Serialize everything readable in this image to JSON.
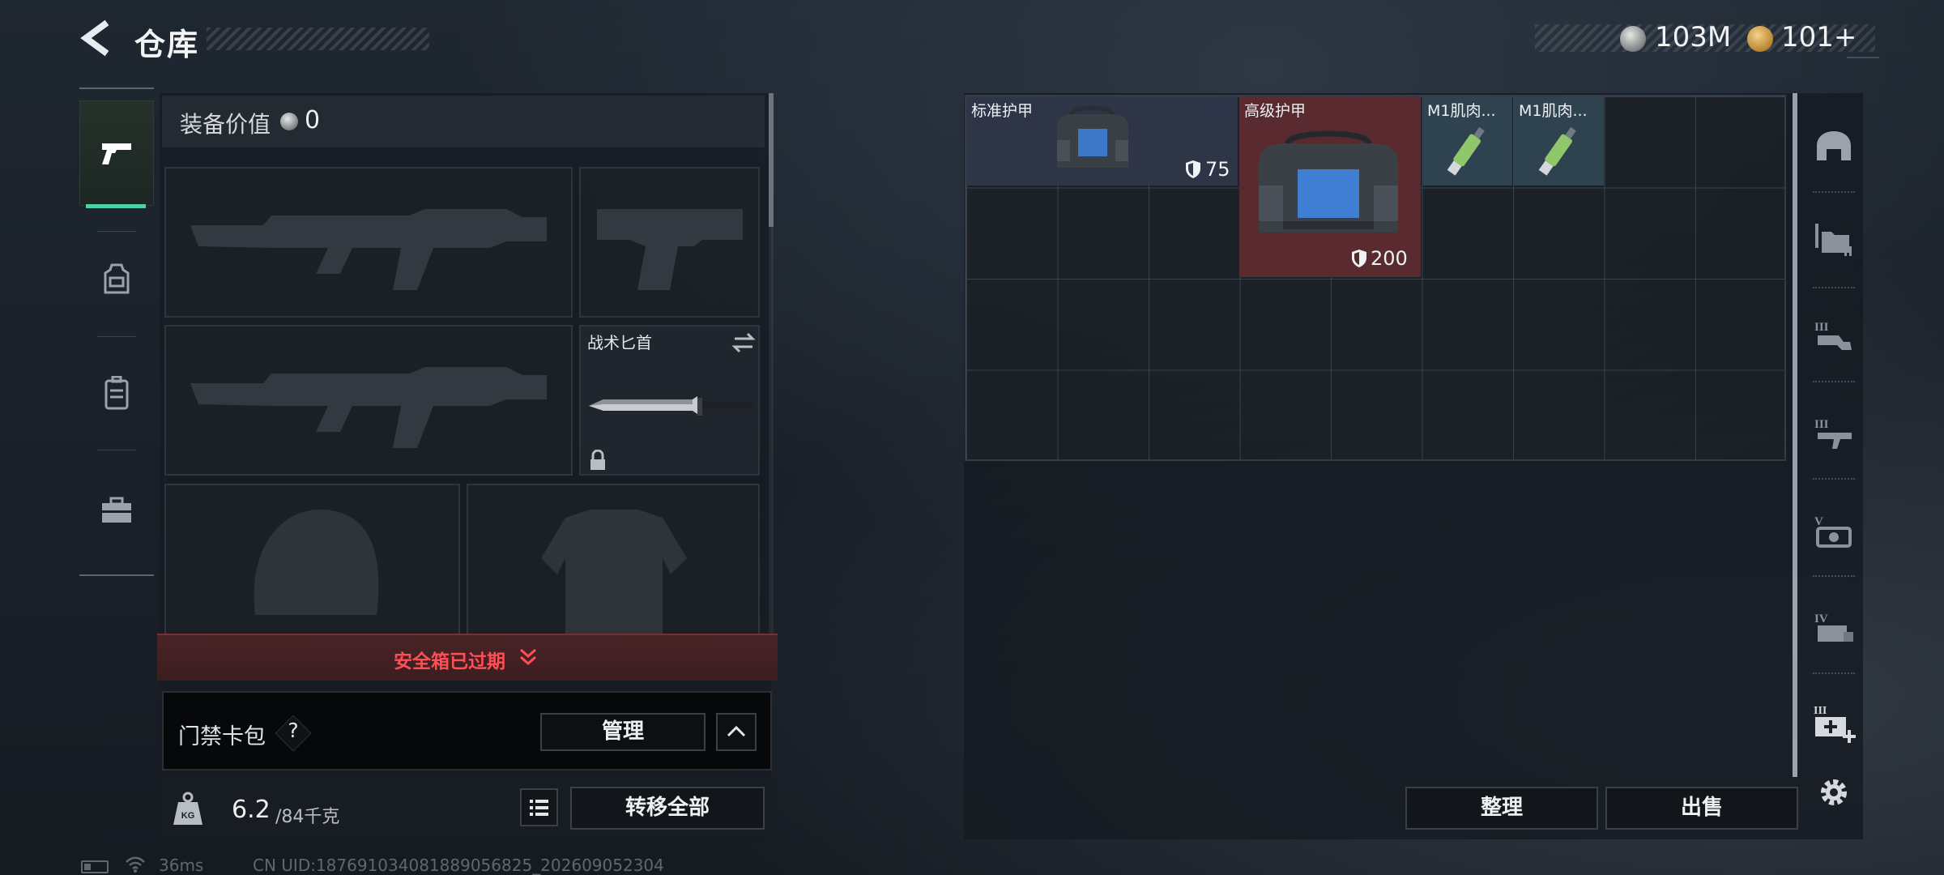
{
  "header": {
    "title": "仓库"
  },
  "currency": [
    {
      "icon": "silver-coin-icon",
      "value": "103M"
    },
    {
      "icon": "gold-coin-icon",
      "value": "101+"
    }
  ],
  "categories": [
    {
      "icon": "pistol-icon",
      "active": true
    },
    {
      "icon": "gear-vest-icon",
      "active": false
    },
    {
      "icon": "backpack-icon",
      "active": false
    },
    {
      "icon": "toolbox-icon",
      "active": false
    }
  ],
  "equipment": {
    "value_label": "装备价值",
    "value": "0",
    "knife_name": "战术匕首",
    "safebox_status": "安全箱已过期",
    "keycard_label": "门禁卡包",
    "keycard_help": "?",
    "manage_label": "管理",
    "weight_current": "6.2",
    "weight_max": "/84千克",
    "transfer_all_label": "转移全部"
  },
  "stash": {
    "items": [
      {
        "name": "标准护甲",
        "armor": "75"
      },
      {
        "name": "高级护甲",
        "armor": "200"
      },
      {
        "name": "M1肌肉..."
      },
      {
        "name": "M1肌肉..."
      }
    ],
    "sort_label": "整理",
    "sell_label": "出售"
  },
  "right_tabs": [
    "helmet-tab-icon",
    "folder-tab-icon",
    "level3-item-tab-icon",
    "level3-gun-tab-icon",
    "level5-gun-tab-icon",
    "level4-box-tab-icon",
    "medkit-add-tab-icon",
    "settings-gear-icon"
  ],
  "status": {
    "ping": "36ms",
    "uid": "CN UID:18769103408188905682​5_202609052304"
  },
  "colors": {
    "accent_active": "#4fd1a6",
    "safebox_warning": "#ff4f55",
    "advanced_armor_bg": "#5a2a31",
    "standard_armor_bg": "#30384e"
  }
}
